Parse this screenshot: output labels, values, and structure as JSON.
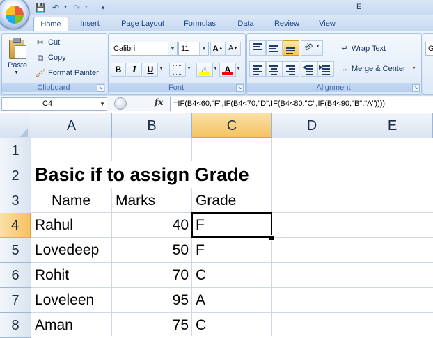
{
  "window": {
    "title": "E"
  },
  "ribbon": {
    "tabs": [
      "Home",
      "Insert",
      "Page Layout",
      "Formulas",
      "Data",
      "Review",
      "View"
    ],
    "clipboard": {
      "paste": "Paste",
      "cut": "Cut",
      "copy": "Copy",
      "format_painter": "Format Painter",
      "label": "Clipboard"
    },
    "font": {
      "name": "Calibri",
      "size": "11",
      "bold": "B",
      "italic": "I",
      "underline": "U",
      "font_color_letter": "A",
      "label": "Font"
    },
    "alignment": {
      "wrap_text": "Wrap Text",
      "merge_center": "Merge & Center",
      "label": "Alignment"
    },
    "number_partial": "G"
  },
  "formula_bar": {
    "name_box": "C4",
    "fx": "fx",
    "formula": "=IF(B4<60,\"F\",IF(B4<70,\"D\",IF(B4<80,\"C\",IF(B4<90,\"B\",\"A\"))))"
  },
  "sheet": {
    "columns": [
      "A",
      "B",
      "C",
      "D",
      "E"
    ],
    "rows": [
      "1",
      "2",
      "3",
      "4",
      "5",
      "6",
      "7",
      "8"
    ],
    "selected_cell": "C4",
    "title": "Basic if to assign Grade",
    "headers": {
      "name": "Name",
      "marks": "Marks",
      "grade": "Grade"
    },
    "data": [
      {
        "name": "Rahul",
        "marks": "40",
        "grade": "F"
      },
      {
        "name": "Lovedeep",
        "marks": "50",
        "grade": "F"
      },
      {
        "name": "Rohit",
        "marks": "70",
        "grade": "C"
      },
      {
        "name": "Loveleen",
        "marks": "95",
        "grade": "A"
      },
      {
        "name": "Aman",
        "marks": "75",
        "grade": "C"
      }
    ]
  },
  "colors": {
    "selection_header": "#f6c25f",
    "ribbon_text": "#15428b",
    "font_color_red": "#ff0000",
    "highlight_yellow": "#ffff00"
  }
}
